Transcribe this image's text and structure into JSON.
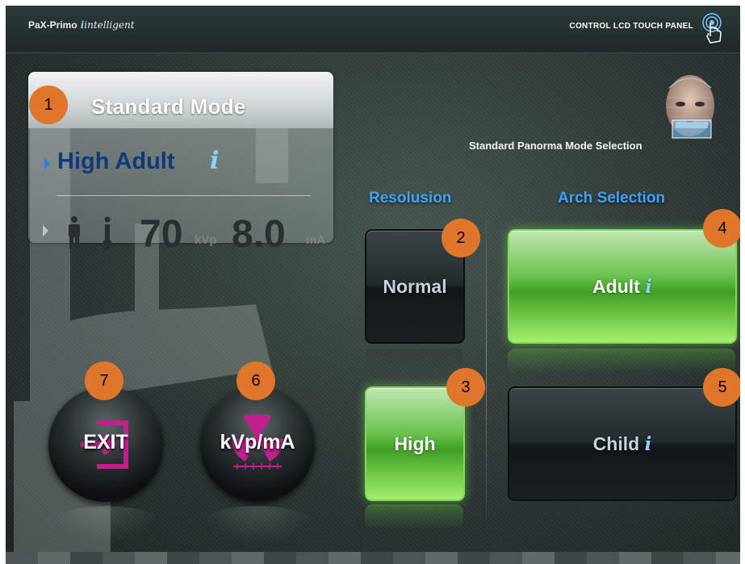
{
  "header": {
    "brand": "PaX-Primo",
    "brand_suffix": "intelligent",
    "brand_i": "i",
    "panel_title": "CONTROL LCD TOUCH PANEL"
  },
  "mode_card": {
    "title": "Standard  Mode",
    "sub_mode": "High Adult",
    "info_i": "i",
    "kvp_value": "70",
    "kvp_unit": "kVp",
    "ma_value": "8.0",
    "ma_unit": "mA"
  },
  "mode_selection_label": "Standard Panorma Mode Selection",
  "resolution": {
    "title": "Resolusion",
    "normal_label": "Normal",
    "high_label": "High",
    "selected": "High"
  },
  "arch": {
    "title": "Arch Selection",
    "adult_label": "Adult",
    "child_label": "Child",
    "i_glyph": "i",
    "selected": "Adult"
  },
  "actions": {
    "exit_label": "EXIT",
    "kvp_label": "kVp/mA"
  },
  "badges": [
    "1",
    "2",
    "3",
    "4",
    "5",
    "6",
    "7"
  ],
  "colors": {
    "badge": "#e07629",
    "selected_green": "#6cc351",
    "title_blue": "#3ea3ff",
    "sub_mode_blue": "#0e3a78",
    "exit_magenta": "#c0208c"
  }
}
